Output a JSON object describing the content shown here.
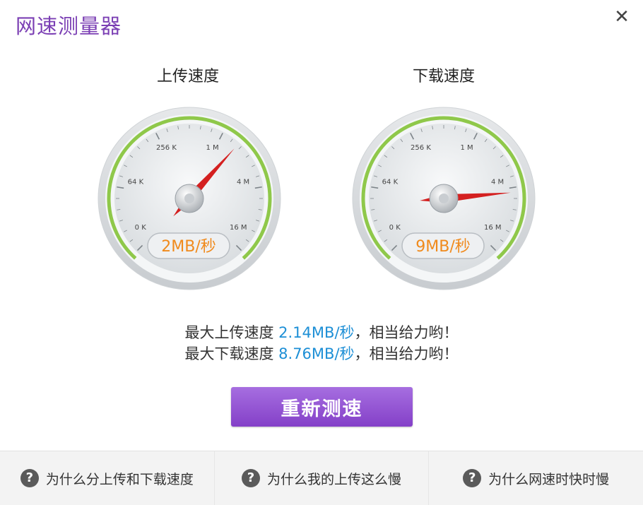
{
  "window": {
    "title": "网速测量器",
    "close_label": "✕"
  },
  "upload": {
    "title": "上传速度",
    "readout": "2MB/秒",
    "needle_angle": 42,
    "scale": [
      "0 K",
      "64 K",
      "256 K",
      "1 M",
      "4 M",
      "16 M"
    ]
  },
  "download": {
    "title": "下载速度",
    "readout": "9MB/秒",
    "needle_angle": 85,
    "scale": [
      "0 K",
      "64 K",
      "256 K",
      "1 M",
      "4 M",
      "16 M"
    ]
  },
  "summary": {
    "upload_prefix": "最大上传速度",
    "upload_value": "2.14MB/秒",
    "upload_suffix": "，相当给力哟！",
    "download_prefix": "最大下载速度",
    "download_value": "8.76MB/秒",
    "download_suffix": "，相当给力哟！"
  },
  "retest_label": "重新测速",
  "footer": {
    "links": [
      {
        "label": "为什么分上传和下载速度",
        "icon": "question-icon"
      },
      {
        "label": "为什么我的上传这么慢",
        "icon": "question-icon"
      },
      {
        "label": "为什么网速时快时慢",
        "icon": "question-icon"
      }
    ]
  },
  "colors": {
    "title": "#7b3fb4",
    "accent_value": "#1d8fd6",
    "readout": "#f08a1c",
    "needle": "#d42020",
    "button": "#9354d4",
    "arc": "#8fc84a"
  }
}
